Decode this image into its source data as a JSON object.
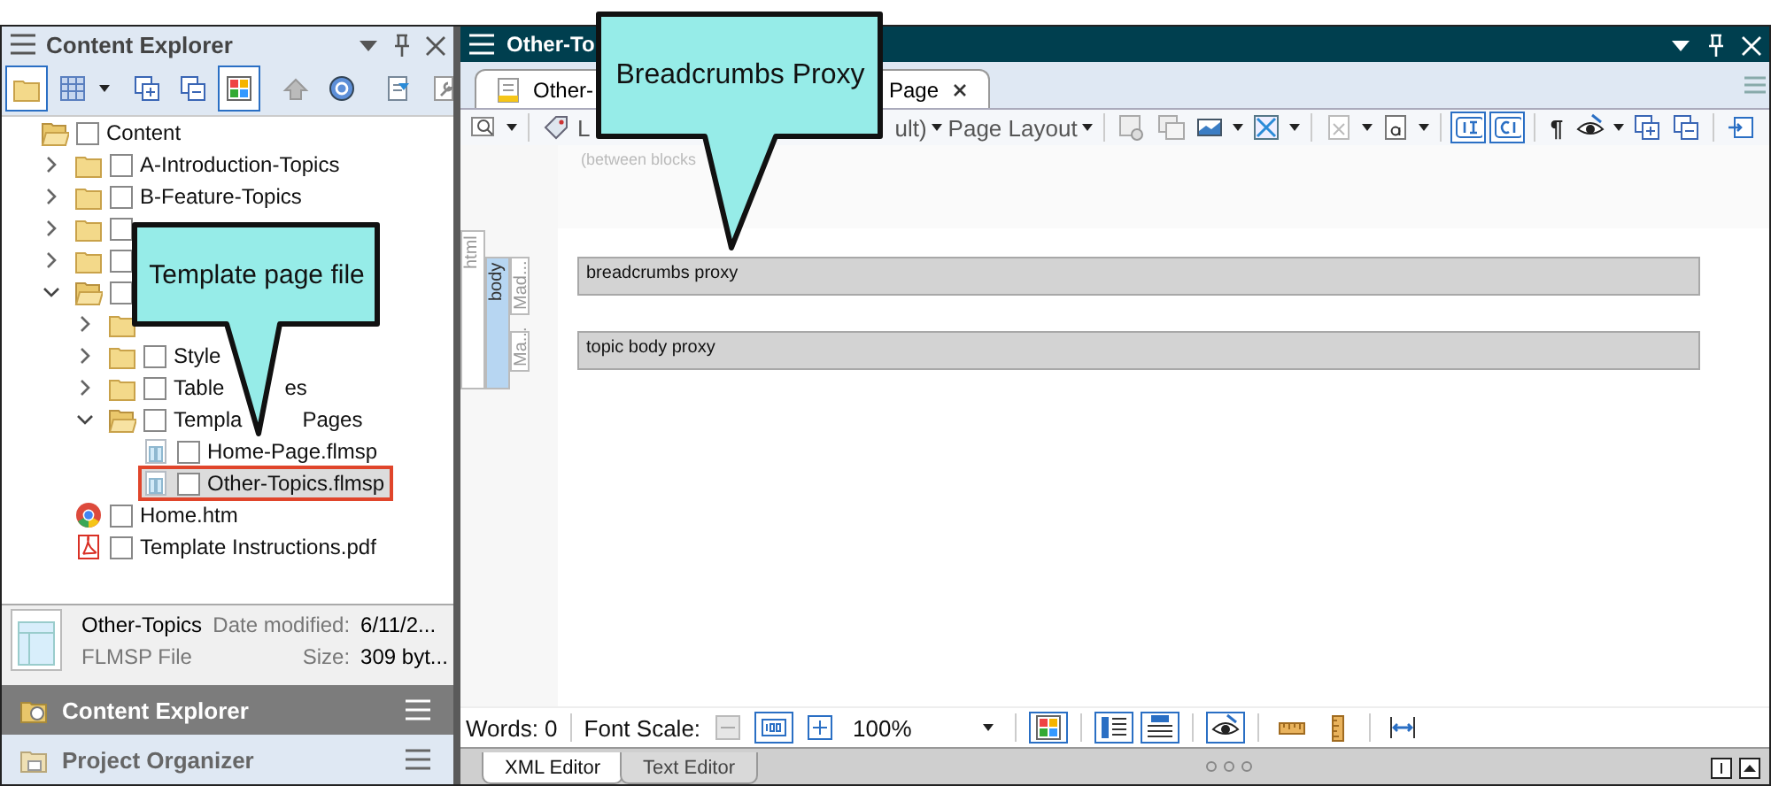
{
  "explorer": {
    "title": "Content Explorer",
    "toolbar": [
      {
        "on": true
      },
      {
        "on": false
      },
      {
        "on": false
      },
      {
        "on": false
      },
      {
        "on": true
      },
      {
        "on": false
      },
      {
        "on": false
      },
      {
        "on": false
      },
      {
        "on": false
      }
    ],
    "tree": [
      {
        "label": "Content",
        "kind": "folder",
        "expanded": true,
        "checked": false,
        "selected": false,
        "children": [
          {
            "label": "A-Introduction-Topics",
            "kind": "folder",
            "expanded": false,
            "checked": false,
            "selected": false
          },
          {
            "label": "B-Feature-Topics",
            "kind": "folder",
            "expanded": false,
            "checked": false,
            "selected": false
          },
          {
            "kind": "folder",
            "expanded": false,
            "checked": false,
            "selected": false
          },
          {
            "kind": "folder",
            "expanded": false,
            "checked": false,
            "selected": false
          },
          {
            "kind": "folder",
            "expanded": true,
            "checked": false,
            "selected": false,
            "children": [
              {
                "kind": "folder",
                "expanded": false,
                "selected": false
              },
              {
                "label": "Style",
                "kind": "folder",
                "expanded": false,
                "checked": false,
                "selected": false
              },
              {
                "label": "Table",
                "label_end": "es",
                "kind": "folder",
                "expanded": false,
                "checked": false,
                "selected": false
              },
              {
                "label": "Templa",
                "label_end": "Pages",
                "kind": "folder",
                "expanded": true,
                "checked": false,
                "selected": false,
                "children": [
                  {
                    "label": "Home-Page.flmsp",
                    "kind": "template",
                    "checked": false,
                    "selected": false
                  },
                  {
                    "label": "Other-Topics.flmsp",
                    "kind": "template",
                    "checked": false,
                    "selected": true
                  }
                ]
              }
            ]
          },
          {
            "label": "Home.htm",
            "kind": "browser",
            "checked": false,
            "selected": false
          },
          {
            "label": "Template Instructions.pdf",
            "kind": "pdf",
            "checked": false,
            "selected": false
          }
        ]
      }
    ],
    "details": {
      "name": "Other-Topics",
      "type": "FLMSP File",
      "date_label": "Date modified:",
      "date": "6/11/2...",
      "size_label": "Size:",
      "size": "309 byt..."
    },
    "panels": [
      {
        "label": "Content Explorer",
        "selected": true
      },
      {
        "label": "Project Organizer",
        "selected": false
      }
    ]
  },
  "editor": {
    "title": "Other-To",
    "tab": {
      "label_start": "Other-",
      "label_end": "Page",
      "selected": true
    },
    "toolbar": {
      "layout_start": "L",
      "layout_end": "ult)",
      "page_layout": "Page Layout",
      "pilcrow": "¶",
      "toggles": [
        {
          "on": false
        },
        {
          "on": false
        },
        {
          "on": false
        },
        {
          "on": false
        },
        {
          "on": false
        },
        {
          "on": false
        },
        {
          "on": false
        },
        {
          "on": false
        },
        {
          "on": true
        },
        {
          "on": true
        },
        {
          "on": false
        },
        {
          "on": false
        },
        {
          "on": false
        },
        {
          "on": false
        }
      ]
    },
    "hint": "(between blocks",
    "structure": [
      {
        "label": "html",
        "selected": false
      },
      {
        "label": "body",
        "selected": true
      },
      {
        "label": "Mad...",
        "selected": false
      },
      {
        "label": "Ma...",
        "selected": false
      }
    ],
    "blocks": [
      {
        "text": "breadcrumbs proxy"
      },
      {
        "text": "topic body proxy"
      }
    ],
    "status": {
      "words": "Words: 0",
      "font_scale": "Font Scale:",
      "zoom": "100%",
      "toggles": [
        {
          "on": false
        },
        {
          "on": true
        },
        {
          "on": false
        },
        {
          "on": true
        },
        {
          "on": true
        },
        {
          "on": true
        },
        {
          "on": true
        },
        {
          "on": false
        },
        {
          "on": false
        },
        {
          "on": false
        }
      ]
    },
    "modes": [
      {
        "label": "XML Editor",
        "selected": true
      },
      {
        "label": "Text Editor",
        "selected": false
      }
    ]
  },
  "callouts": [
    {
      "text": "Template page file"
    },
    {
      "text": "Breadcrumbs Proxy"
    }
  ]
}
